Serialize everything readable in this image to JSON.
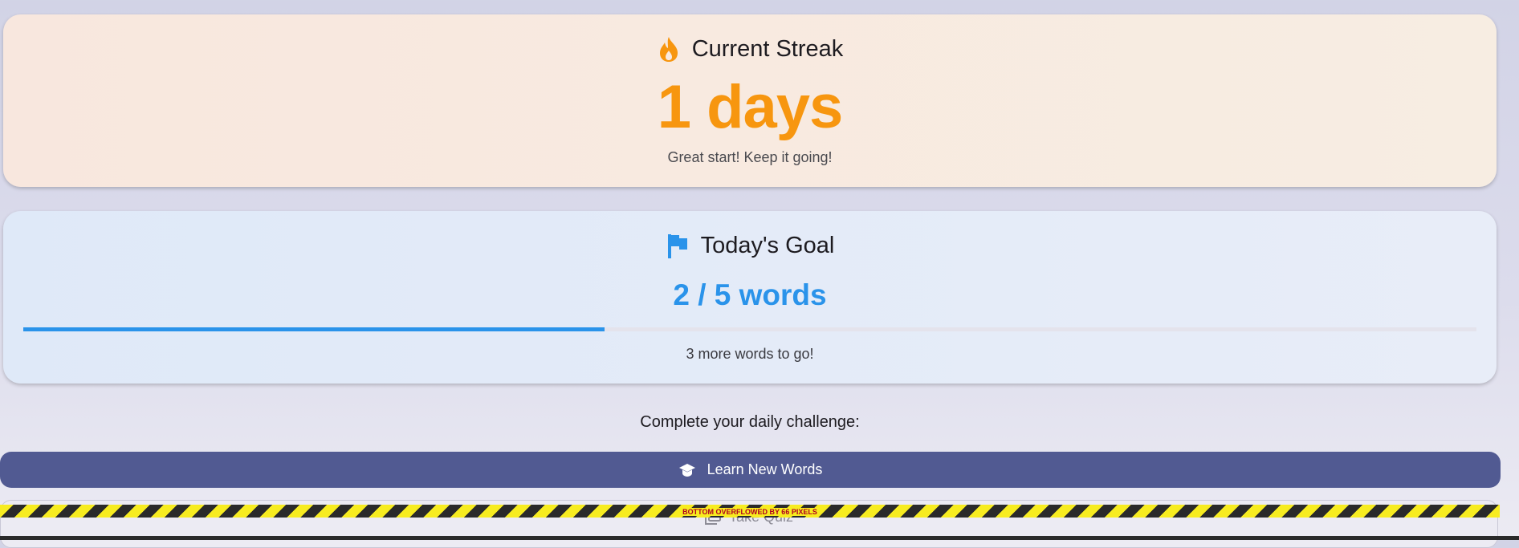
{
  "streak": {
    "title": "Current Streak",
    "value": "1 days",
    "message": "Great start! Keep it going!",
    "icon": "fire-icon",
    "accent_color": "#f7960f"
  },
  "goal": {
    "title": "Today's Goal",
    "value": "2 / 5 words",
    "progress": 0.4,
    "message": "3 more words to go!",
    "icon": "flag-icon",
    "accent_color": "#2a93ea"
  },
  "challenge": {
    "label": "Complete your daily challenge:"
  },
  "actions": {
    "learn_label": "Learn New Words",
    "learn_icon": "graduation-cap-icon",
    "quiz_label": "Take Quiz",
    "quiz_icon": "quiz-icon"
  },
  "overflow": {
    "text": "BOTTOM OVERFLOWED BY 66 PIXELS"
  }
}
